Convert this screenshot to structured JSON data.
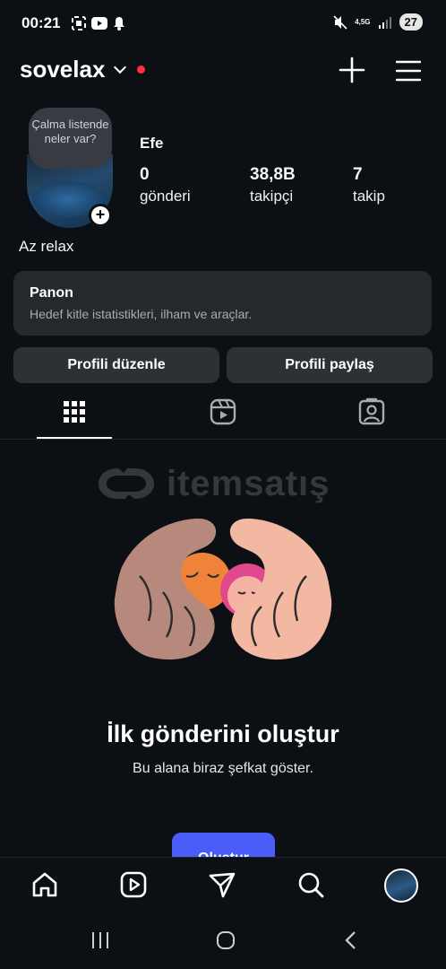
{
  "status_bar": {
    "time": "00:21",
    "network": "4,5G",
    "battery": "27"
  },
  "header": {
    "username": "sovelax"
  },
  "profile": {
    "note_bubble": "Çalma listende neler var?",
    "name": "Efe",
    "stats": [
      {
        "value": "0",
        "label": "gönderi"
      },
      {
        "value": "38,8B",
        "label": "takipçi"
      },
      {
        "value": "7",
        "label": "takip"
      }
    ],
    "bio": "Az relax"
  },
  "dashboard": {
    "title": "Panon",
    "subtitle": "Hedef kitle istatistikleri, ilham ve araçlar."
  },
  "actions": {
    "edit_profile": "Profili düzenle",
    "share_profile": "Profili paylaş"
  },
  "tabs": [
    "grid-icon",
    "reels-icon",
    "tagged-icon"
  ],
  "watermark": "itemsatış",
  "empty_state": {
    "title": "İlk gönderini oluştur",
    "subtitle": "Bu alana biraz şefkat göster.",
    "button": "Oluştur"
  },
  "colors": {
    "background": "#0c1014",
    "accent": "#4a5df9",
    "notification_dot": "#ff3040"
  }
}
